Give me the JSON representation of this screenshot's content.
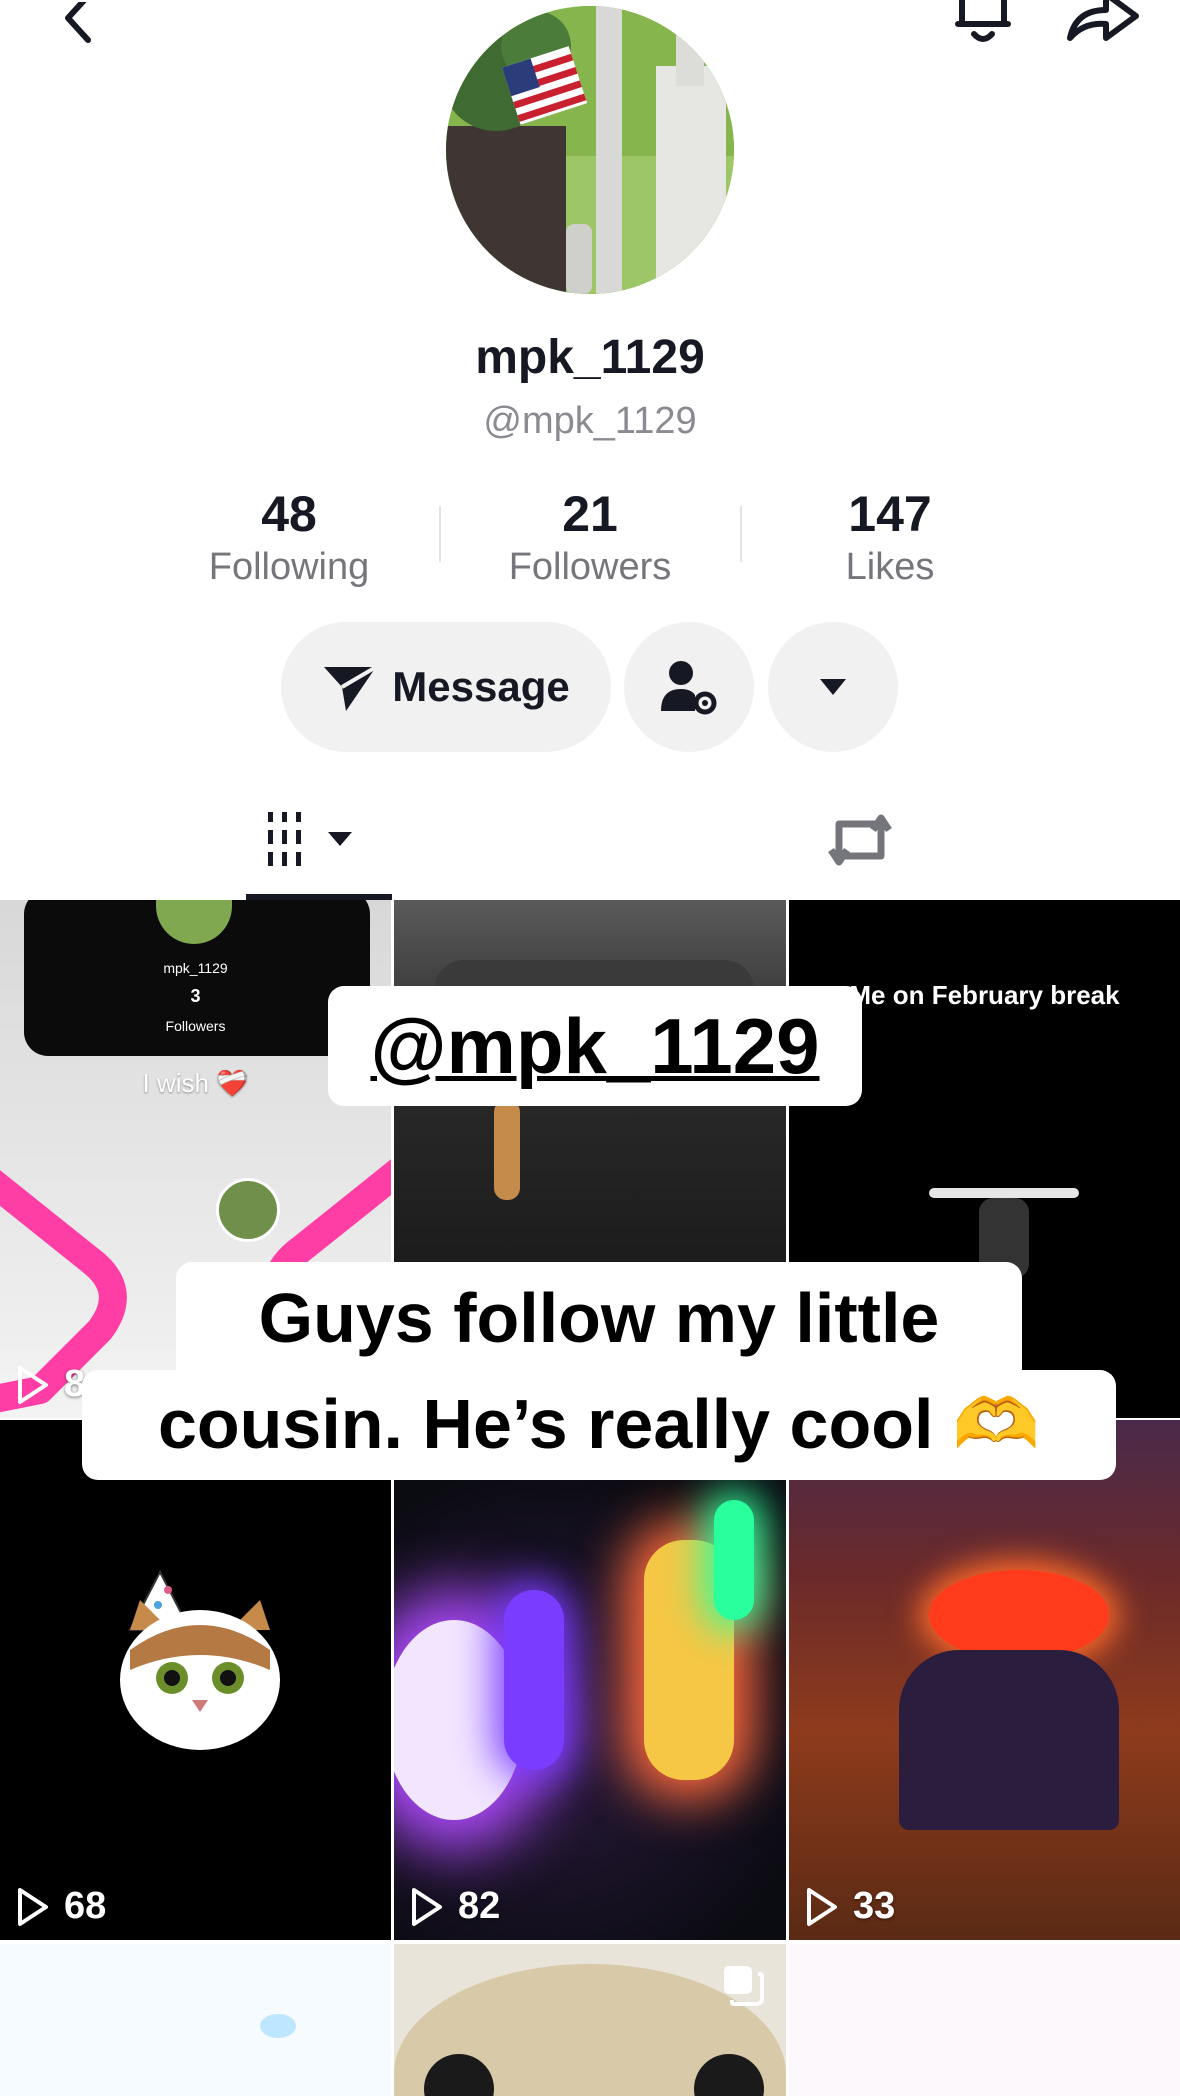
{
  "profile": {
    "display_name": "mpk_1129",
    "handle": "@mpk_1129"
  },
  "stats": [
    {
      "value": "48",
      "label": "Following"
    },
    {
      "value": "21",
      "label": "Followers"
    },
    {
      "value": "147",
      "label": "Likes"
    }
  ],
  "actions": {
    "message_label": "Message"
  },
  "icons": {
    "back": "chevron-left-icon",
    "notifications": "bell-icon",
    "share": "share-arrow-icon",
    "message": "send-arrow-icon",
    "friend_settings": "user-gear-icon",
    "more": "caret-down-icon",
    "videos_tab": "grid-columns-icon",
    "reposts_tab": "repost-icon",
    "play": "play-outline-icon"
  },
  "videos": [
    {
      "id": "v1",
      "views": "8",
      "text_top_name": "mpk_1129",
      "text_top_count": "3",
      "text_top_label": "Followers",
      "caption": "I wish ❤️‍🩹"
    },
    {
      "id": "v2",
      "views": ""
    },
    {
      "id": "v3",
      "views": "",
      "caption": "Me on February break"
    },
    {
      "id": "v4",
      "views": "68"
    },
    {
      "id": "v5",
      "views": "82"
    },
    {
      "id": "v6",
      "views": "33"
    },
    {
      "id": "v7",
      "views": ""
    },
    {
      "id": "v8",
      "views": ""
    },
    {
      "id": "v9",
      "views": ""
    }
  ],
  "overlay": {
    "mention": "@mpk_1129",
    "caption_line1": "Guys follow my little",
    "caption_line2": "cousin. He’s really cool 🫶"
  },
  "colors": {
    "accent_pink": "#ff3ea5",
    "text_primary": "#161823",
    "text_secondary": "#75767c",
    "pill_bg": "#f1f1f2"
  }
}
